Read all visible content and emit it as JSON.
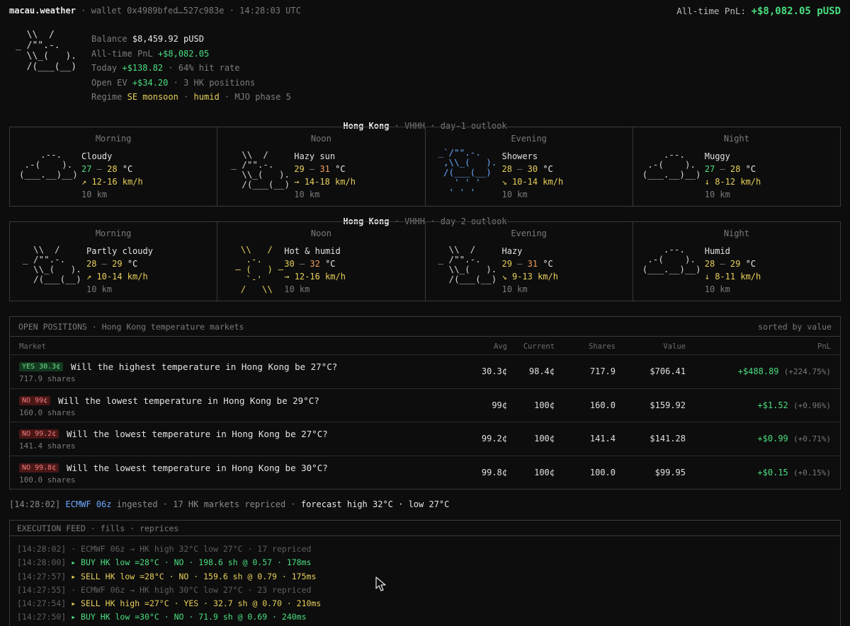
{
  "header": {
    "app": "macau.weather",
    "wallet": "wallet 0x4989bfed…527c983e",
    "time": "14:28:03 UTC",
    "pnl_label": "All-time PnL:",
    "pnl_value": "+$8,082.05 pUSD"
  },
  "logo_art": "  \\\\  /\n_ /\"\".-.\n  \\\\_(   ).\n  /(___(__)",
  "summary": {
    "balance_label": "Balance",
    "balance_value": "$8,459.92 pUSD",
    "pnl_label": "All-time PnL",
    "pnl_value": "+$8,082.05",
    "today_label": "Today",
    "today_value": "+$138.82",
    "today_rate": "· 64% hit rate",
    "ev_label": "Open EV",
    "ev_value": "+$34.20",
    "ev_positions": "· 3 HK positions",
    "regime_label": "Regime",
    "regime_monsoon": "SE monsoon",
    "regime_sep": "·",
    "regime_humid": "humid",
    "regime_mjo": "· MJO phase 5"
  },
  "outlooks": [
    {
      "city": "Hong Kong",
      "station": "· VHHH ·",
      "label": "day-1 outlook",
      "periods": [
        {
          "name": "Morning",
          "art": "    .--.\n .-(    ).\n(___.__)__)",
          "art_color": "#d6d6d6",
          "cond": "Cloudy",
          "lo": "27",
          "hi": "28",
          "lo_color": "#4ade80",
          "hi_color": "#e8d05a",
          "unit": "°C",
          "wind": "↗ 12-16 km/h",
          "vis": "10 km"
        },
        {
          "name": "Noon",
          "art": "  \\\\  /\n_ /\"\".-.\n  \\\\_(   ).\n  /(___(__)",
          "art_color": "#d6d6d6",
          "cond": "Hazy sun",
          "lo": "29",
          "hi": "31",
          "lo_color": "#e8d05a",
          "hi_color": "#f59e58",
          "unit": "°C",
          "wind": "→ 14-18 km/h",
          "vis": "10 km"
        },
        {
          "name": "Evening",
          "art": "_`/\"\".-.\n ,\\\\_(   ).\n /(___(__)\n   ' ' '\n  ' ' '",
          "art_color": "#6aa8ff",
          "cond": "Showers",
          "lo": "28",
          "hi": "30",
          "lo_color": "#e8d05a",
          "hi_color": "#e8d05a",
          "unit": "°C",
          "wind": "↘ 10-14 km/h",
          "vis": "10 km"
        },
        {
          "name": "Night",
          "art": "    .--.\n .-(    ).\n(___.__)__)",
          "art_color": "#d6d6d6",
          "cond": "Muggy",
          "lo": "27",
          "hi": "28",
          "lo_color": "#4ade80",
          "hi_color": "#e8d05a",
          "unit": "°C",
          "wind": "↓ 8-12 km/h",
          "vis": "10 km"
        }
      ]
    },
    {
      "city": "Hong Kong",
      "station": "· VHHH ·",
      "label": "day-2 outlook",
      "periods": [
        {
          "name": "Morning",
          "art": "  \\\\  /\n_ /\"\".-.\n  \\\\_(   ).\n  /(___(__)",
          "art_color": "#d6d6d6",
          "cond": "Partly cloudy",
          "lo": "28",
          "hi": "29",
          "lo_color": "#e8d05a",
          "hi_color": "#e8d05a",
          "unit": "°C",
          "wind": "↗ 10-14 km/h",
          "vis": "10 km"
        },
        {
          "name": "Noon",
          "art": " \\\\   /\n  .-.\n― (   ) ―\n  `-'\n /   \\\\",
          "art_color": "#e8d05a",
          "cond": "Hot & humid",
          "lo": "30",
          "hi": "32",
          "lo_color": "#e8d05a",
          "hi_color": "#f59e58",
          "unit": "°C",
          "wind": "→ 12-16 km/h",
          "vis": "10 km"
        },
        {
          "name": "Evening",
          "art": "  \\\\  /\n_ /\"\".-.\n  \\\\_(   ).\n  /(___(__)",
          "art_color": "#d6d6d6",
          "cond": "Hazy",
          "lo": "29",
          "hi": "31",
          "lo_color": "#e8d05a",
          "hi_color": "#f59e58",
          "unit": "°C",
          "wind": "↘ 9-13 km/h",
          "vis": "10 km"
        },
        {
          "name": "Night",
          "art": "    .--.\n .-(    ).\n(___.__)__)",
          "art_color": "#d6d6d6",
          "cond": "Humid",
          "lo": "28",
          "hi": "29",
          "lo_color": "#e8d05a",
          "hi_color": "#e8d05a",
          "unit": "°C",
          "wind": "↓ 8-11 km/h",
          "vis": "10 km"
        }
      ]
    }
  ],
  "positions": {
    "title": "OPEN POSITIONS · Hong Kong temperature markets",
    "sort": "sorted by value",
    "columns": {
      "market": "Market",
      "avg": "Avg",
      "current": "Current",
      "shares": "Shares",
      "value": "Value",
      "pnl": "PnL"
    },
    "rows": [
      {
        "side": "YES",
        "price": "30.3¢",
        "question": "Will the highest temperature in Hong Kong be 27°C?",
        "shares_line": "717.9 shares",
        "avg": "30.3¢",
        "current": "98.4¢",
        "shares": "717.9",
        "value": "$706.41",
        "pnl": "+$488.89",
        "pnl_pct": "(+224.75%)"
      },
      {
        "side": "NO",
        "price": "99¢",
        "question": "Will the lowest temperature in Hong Kong be 29°C?",
        "shares_line": "160.0 shares",
        "avg": "99¢",
        "current": "100¢",
        "shares": "160.0",
        "value": "$159.92",
        "pnl": "+$1.52",
        "pnl_pct": "(+0.96%)"
      },
      {
        "side": "NO",
        "price": "99.2¢",
        "question": "Will the lowest temperature in Hong Kong be 27°C?",
        "shares_line": "141.4 shares",
        "avg": "99.2¢",
        "current": "100¢",
        "shares": "141.4",
        "value": "$141.28",
        "pnl": "+$0.99",
        "pnl_pct": "(+0.71%)"
      },
      {
        "side": "NO",
        "price": "99.8¢",
        "question": "Will the lowest temperature in Hong Kong be 30°C?",
        "shares_line": "100.0 shares",
        "avg": "99.8¢",
        "current": "100¢",
        "shares": "100.0",
        "value": "$99.95",
        "pnl": "+$0.15",
        "pnl_pct": "(+0.15%)"
      }
    ]
  },
  "status": {
    "time": "[14:28:02]",
    "model": "ECMWF 06z",
    "text": "ingested · 17 HK markets repriced ·",
    "forecast": "forecast high 32°C · low 27°C"
  },
  "feed": {
    "title": "EXECUTION FEED · fills · reprices",
    "lines": [
      {
        "ts": "[14:28:02]",
        "kind": "info",
        "text": "· ECMWF 06z → HK high 32°C low 27°C · 17 repriced"
      },
      {
        "ts": "[14:28:00]",
        "kind": "buy",
        "text": "▸ BUY HK low =28°C · NO · 198.6 sh @ 0.57 · 178ms"
      },
      {
        "ts": "[14:27:57]",
        "kind": "sell",
        "text": "▸ SELL HK low =28°C · NO · 159.6 sh @ 0.79 · 175ms"
      },
      {
        "ts": "[14:27:55]",
        "kind": "info",
        "text": "· ECMWF 06z → HK high 30°C low 27°C · 23 repriced"
      },
      {
        "ts": "[14:27:54]",
        "kind": "sell",
        "text": "▸ SELL HK high =27°C · YES · 32.7 sh @ 0.70 · 210ms"
      },
      {
        "ts": "[14:27:50]",
        "kind": "buy",
        "text": "▸ BUY HK low =30°C · NO · 71.9 sh @ 0.69 · 240ms"
      }
    ]
  }
}
